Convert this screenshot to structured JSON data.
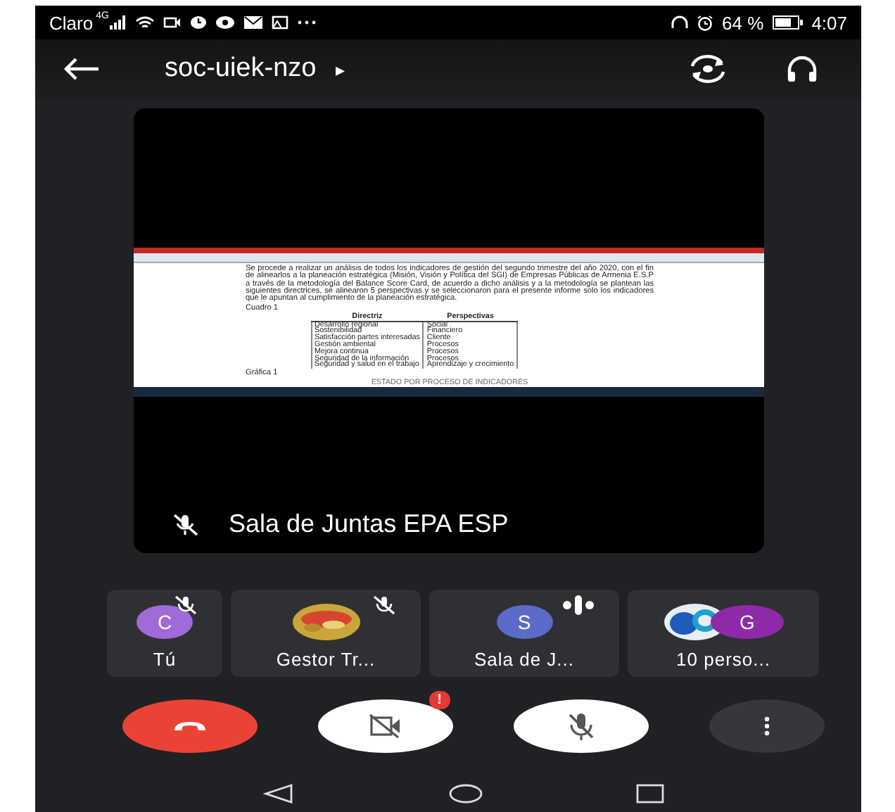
{
  "status_bar": {
    "carrier": "Claro",
    "network": "4G",
    "battery_text": "64 %",
    "time": "4:07"
  },
  "meeting": {
    "code": "soc-uiek-nzo",
    "more": "▸"
  },
  "presentation": {
    "presenter": "Sala de Juntas EPA ESP",
    "presenter_muted": true,
    "document": {
      "paragraph": "Se procede a realizar un análisis de todos los indicadores de gestión del segundo trimestre del año 2020, con el fin de alinearlos a la planeación estratégica (Misión, Visión y Política del SGI) de Empresas Públicas de Armenia E.S.P a través de la metodología del Balance Score Card, de acuerdo a dicho análisis y a la metodología se plantean las siguientes directrices, se alinearon 5 perspectivas y se seleccionaron para el presente informe solo los indicadores que le apuntan al cumplimiento de la planeación estratégica.",
      "table_caption": "Cuadro 1",
      "table": {
        "columns": [
          "Directriz",
          "Perspectivas"
        ],
        "rows": [
          [
            "Desarrollo regional",
            "Social"
          ],
          [
            "Sostenibilidad",
            "Financiero"
          ],
          [
            "Satisfacción partes interesadas",
            "Cliente"
          ],
          [
            "Gestión ambiental",
            "Procesos"
          ],
          [
            "Mejora continua",
            "Procesos"
          ],
          [
            "Seguridad de la información",
            "Procesos"
          ],
          [
            "Seguridad y salud en el trabajo",
            "Aprendizaje y crecimiento"
          ]
        ]
      },
      "chart_caption": "Gráfica 1",
      "chart_title": "ESTADO POR PROCESO DE INDICADORES"
    }
  },
  "participants": [
    {
      "kind": "initial",
      "name": "Tú",
      "initial": "C",
      "color": "#a06ad8",
      "muted": true
    },
    {
      "kind": "picture",
      "name": "Gestor Tr...",
      "muted": true
    },
    {
      "kind": "initial",
      "name": "Sala de J...",
      "initial": "S",
      "color": "#5c6bc8",
      "muted": false
    },
    {
      "kind": "group",
      "name": "10 perso...",
      "initial": "G",
      "color": "#8e2aa8"
    }
  ],
  "controls": {
    "camera_on": false,
    "camera_alert": "!",
    "mic_on": false
  }
}
